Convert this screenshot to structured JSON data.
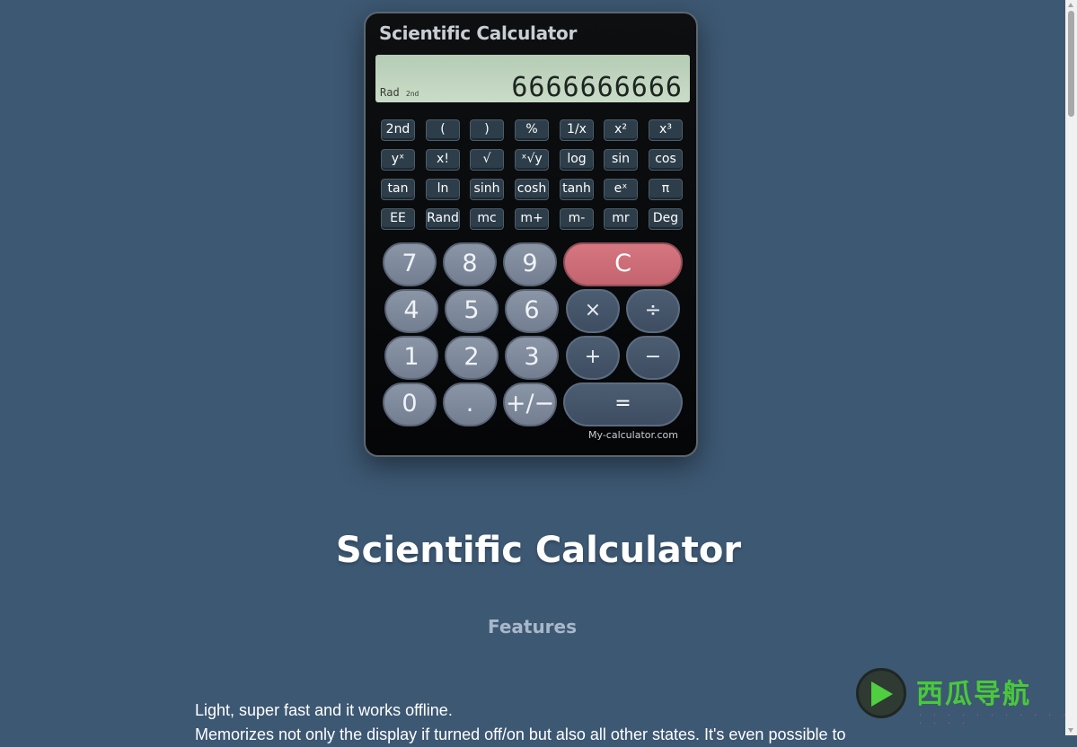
{
  "calculator": {
    "title": "Scientific Calculator",
    "display": {
      "mode": "Rad",
      "mode_sub": "2nd",
      "value": "6666666666"
    },
    "function_keys": [
      [
        "2nd",
        "(",
        ")",
        "%",
        "1/x",
        "x²",
        "x³"
      ],
      [
        "yˣ",
        "x!",
        "√",
        "ˣ√y",
        "log",
        "sin",
        "cos"
      ],
      [
        "tan",
        "ln",
        "sinh",
        "cosh",
        "tanh",
        "eˣ",
        "π"
      ],
      [
        "EE",
        "Rand",
        "mc",
        "m+",
        "m-",
        "mr",
        "Deg"
      ]
    ],
    "keys": {
      "seven": "7",
      "eight": "8",
      "nine": "9",
      "clear": "C",
      "four": "4",
      "five": "5",
      "six": "6",
      "multiply": "×",
      "divide": "÷",
      "one": "1",
      "two": "2",
      "three": "3",
      "plus": "+",
      "minus": "−",
      "zero": "0",
      "decimal": ".",
      "negate": "+/−",
      "equals": "="
    },
    "brand": "My-calculator.com"
  },
  "page": {
    "title": "Scientific Calculator",
    "features_heading": "Features",
    "features": [
      "Light, super fast and it works offline.",
      "Memorizes not only the display if turned off/on but also all other states. It's even possible to"
    ]
  },
  "watermark": {
    "text": "西瓜导航"
  },
  "colors": {
    "background": "#3d5873",
    "clear_key": "#cd6e78",
    "display": "#c2d6c0",
    "watermark_green": "#48c93a"
  }
}
